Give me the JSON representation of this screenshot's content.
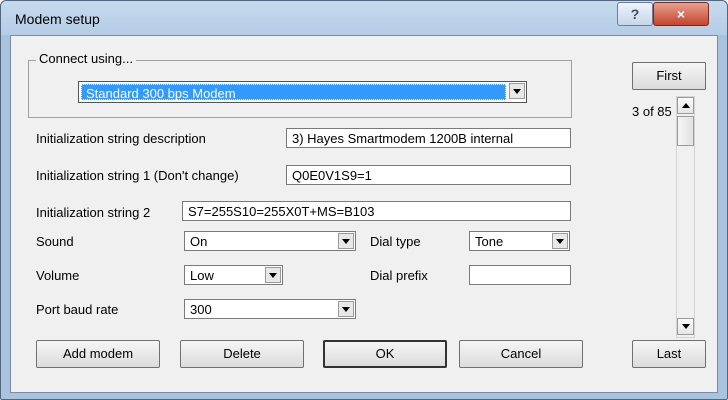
{
  "window": {
    "title": "Modem setup",
    "help_label": "?",
    "close_label": "×"
  },
  "connect": {
    "group_label": "Connect using...",
    "selected_modem": "Standard   300 bps Modem"
  },
  "nav": {
    "first_label": "First",
    "last_label": "Last",
    "record_position": "3 of 85"
  },
  "fields": {
    "init_desc_label": "Initialization string description",
    "init_desc_value": "3) Hayes Smartmodem 1200B internal",
    "init1_label": "Initialization string 1 (Don't change)",
    "init1_value": "Q0E0V1S9=1",
    "init2_label": "Initialization string 2",
    "init2_value": "S7=255S10=255X0T+MS=B103",
    "sound_label": "Sound",
    "sound_value": "On",
    "volume_label": "Volume",
    "volume_value": "Low",
    "port_baud_label": "Port baud rate",
    "port_baud_value": "300",
    "dial_type_label": "Dial type",
    "dial_type_value": "Tone",
    "dial_prefix_label": "Dial prefix",
    "dial_prefix_value": ""
  },
  "buttons": {
    "add_modem": "Add modem",
    "delete": "Delete",
    "ok": "OK",
    "cancel": "Cancel"
  }
}
